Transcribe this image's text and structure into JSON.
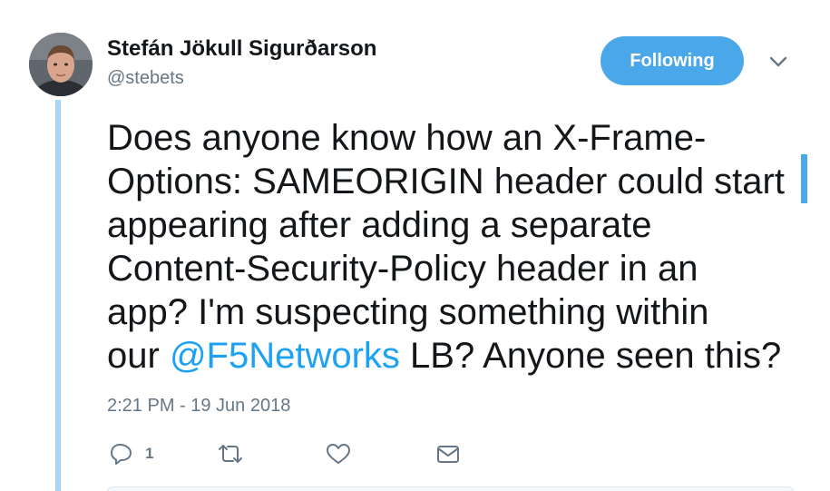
{
  "author": {
    "name": "Stefán Jökull Sigurðarson",
    "handle": "@stebets"
  },
  "follow_button": {
    "label": "Following"
  },
  "tweet": {
    "lines": [
      [
        "Does anyone know how an X-Frame-"
      ],
      [
        "Options: SAMEORIGIN header could start"
      ],
      [
        "appearing after adding a separate"
      ],
      [
        "Content-Security-Policy header in an"
      ],
      [
        "app? I'm suspecting something within"
      ]
    ],
    "last_line_prefix": "our ",
    "mention": "@F5Networks",
    "last_line_suffix": " LB? Anyone seen this?",
    "timestamp": "2:21 PM - 19 Jun 2018"
  },
  "actions": {
    "reply": {
      "icon": "reply-icon",
      "count": "1"
    },
    "retweet": {
      "icon": "retweet-icon"
    },
    "like": {
      "icon": "heart-icon"
    },
    "dm": {
      "icon": "envelope-icon"
    }
  },
  "colors": {
    "accent": "#1da1f2",
    "button": "#4aa7ea",
    "thread_line": "#a9d6f5",
    "muted": "#657786"
  }
}
